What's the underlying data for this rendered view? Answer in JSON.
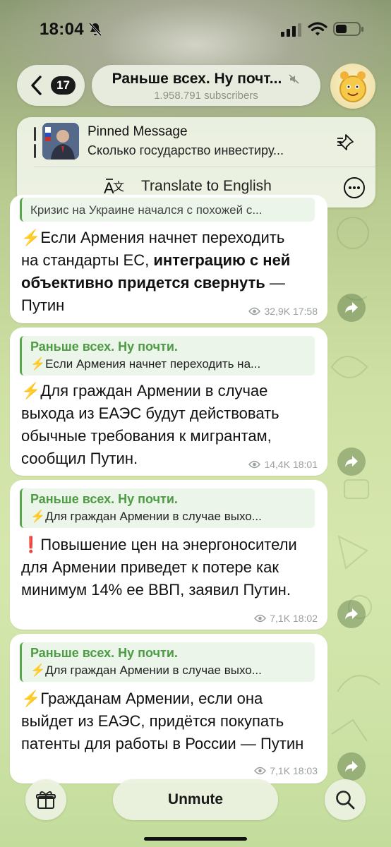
{
  "status_bar": {
    "time": "18:04"
  },
  "header": {
    "back_count": "17",
    "title": "Раньше всех. Ну почт...",
    "subtitle": "1.958.791 subscribers"
  },
  "pinned": {
    "title": "Pinned Message",
    "text": "Сколько государство инвестиру..."
  },
  "translate": {
    "label": "Translate to English"
  },
  "messages": [
    {
      "reply_text": "Кризис на Украине начался с похожей с...",
      "lines": [
        "⚡Если Армения начнет переходить",
        "на стандарты ЕС, "
      ],
      "bold": "интеграцию с ней объективно придется свернуть",
      "tail": " — Путин",
      "views": "32,9K",
      "time": "17:58"
    },
    {
      "reply_name": "Раньше всех. Ну почти.",
      "reply_text": "⚡Если Армения начнет переходить на...",
      "text": "⚡Для граждан Армении в случае выхода из ЕАЭС будут действовать обычные требования к мигрантам, сообщил Путин.",
      "views": "14,4K",
      "time": "18:01"
    },
    {
      "reply_name": "Раньше всех. Ну почти.",
      "reply_text": "⚡Для граждан Армении в случае выхо...",
      "text": "❗Повышение цен на энергоносители для Армении приведет к потере как минимум 14% ее ВВП, заявил Путин.",
      "views": "7,1K",
      "time": "18:02"
    },
    {
      "reply_name": "Раньше всех. Ну почти.",
      "reply_text": "⚡Для граждан Армении в случае выхо...",
      "text": "⚡Гражданам Армении, если она выйдет из ЕАЭС, придётся покупать патенты для работы в России — Путин",
      "views": "7,1K",
      "time": "18:03"
    }
  ],
  "bottom_bar": {
    "unmute_label": "Unmute"
  },
  "colors": {
    "accent_green": "#4d9c43",
    "bubble": "#ffffff",
    "meta": "#9aa09a"
  },
  "icons": [
    "bell-off-icon",
    "signal-icon",
    "wifi-icon",
    "battery-icon",
    "back-chevron-icon",
    "mute-icon",
    "pin-icon",
    "translate-icon",
    "more-icon",
    "eye-icon",
    "share-icon",
    "gift-icon",
    "search-icon"
  ]
}
